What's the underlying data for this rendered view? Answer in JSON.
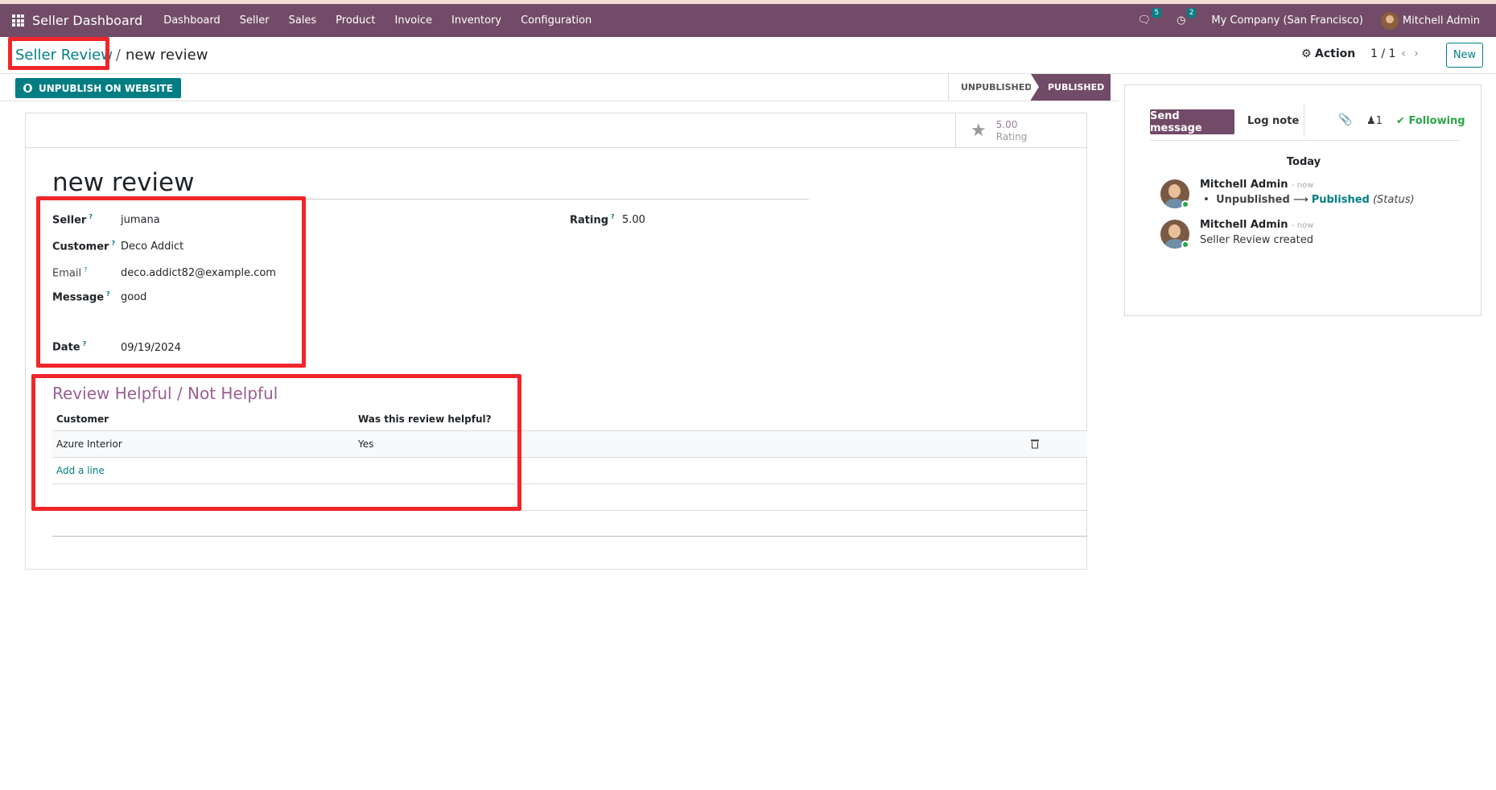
{
  "navbar": {
    "brand": "Seller Dashboard",
    "menu": [
      "Dashboard",
      "Seller",
      "Sales",
      "Product",
      "Invoice",
      "Inventory",
      "Configuration"
    ],
    "messages_badge": "5",
    "activities_badge": "2",
    "company": "My Company (San Francisco)",
    "user": "Mitchell Admin"
  },
  "control_panel": {
    "breadcrumb_parent": "Seller Review",
    "breadcrumb_sep": "/",
    "breadcrumb_current": "new review",
    "action_label": "Action",
    "pager": "1 / 1",
    "new_label": "New"
  },
  "statusbar": {
    "unpublish_label": "UNPUBLISH ON WEBSITE",
    "stages": [
      "UNPUBLISHED",
      "PUBLISHED"
    ],
    "active_stage": "PUBLISHED"
  },
  "sheet": {
    "rating_value": "5.00",
    "rating_label": "Rating",
    "title": "new review",
    "fields": {
      "seller_label": "Seller",
      "seller_value": "jumana",
      "customer_label": "Customer",
      "customer_value": "Deco Addict",
      "email_label": "Email",
      "email_value": "deco.addict82@example.com",
      "message_label": "Message",
      "message_value": "good",
      "date_label": "Date",
      "date_value": "09/19/2024",
      "rating_label": "Rating",
      "rating_value": "5.00"
    },
    "helpful_section": {
      "title": "Review Helpful / Not Helpful",
      "columns": [
        "Customer",
        "Was this review helpful?"
      ],
      "rows": [
        {
          "customer": "Azure Interior",
          "helpful": "Yes"
        }
      ],
      "add_line": "Add a line"
    }
  },
  "chatter": {
    "send_message": "Send message",
    "log_note": "Log note",
    "followers_count": "1",
    "following": "Following",
    "today": "Today",
    "messages": [
      {
        "author": "Mitchell Admin",
        "time": "- now",
        "old": "Unpublished",
        "new": "Published",
        "field": "(Status)"
      },
      {
        "author": "Mitchell Admin",
        "time": "- now",
        "body": "Seller Review created"
      }
    ]
  },
  "colors": {
    "brand": "#714b67",
    "accent": "#017e84",
    "highlight": "#f0262b"
  }
}
